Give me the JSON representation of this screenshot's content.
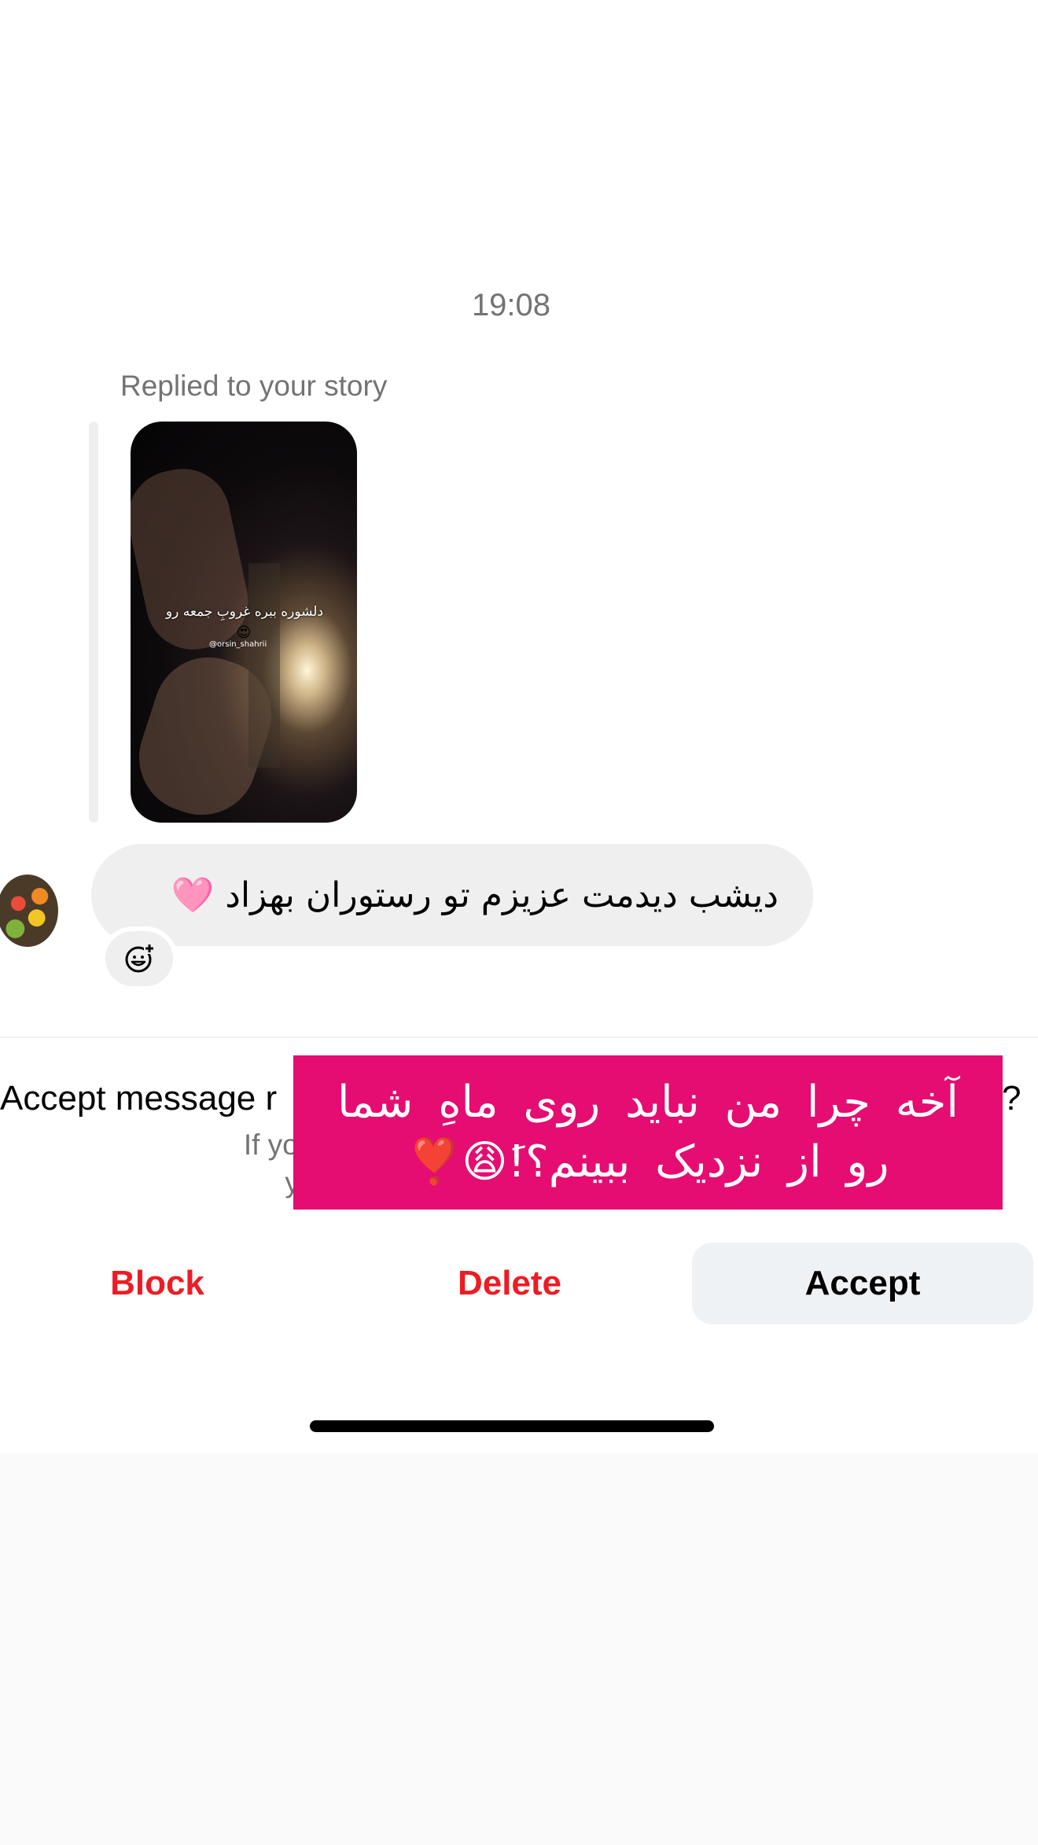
{
  "thread": {
    "timestamp": "19:08",
    "replied_label": "Replied to your story",
    "story": {
      "caption": "دلشوره ببره غروبِ جمعه رو",
      "caption_emoji": "😍",
      "handle": "@orsin_shahrii"
    },
    "message": {
      "text": "دیشب دیدمت عزیزم تو رستوران بهزاد",
      "emoji": "🩷"
    },
    "react_icon": "add-reaction-icon",
    "avatar_icon": "avatar-image"
  },
  "request": {
    "title": "Accept message r",
    "title_end": "?",
    "subtitle_line1": "If you accept, they",
    "subtitle_line2": "your activity"
  },
  "overlay": {
    "text": "آخه چرا من نباید روی ماهِ شما رو از نزدیک ببینم؟!َ😩❣️"
  },
  "actions": {
    "block": "Block",
    "delete": "Delete",
    "accept": "Accept"
  },
  "colors": {
    "destructive": "#ed1c24",
    "overlay": "#e50c72",
    "bubble": "#efefef"
  }
}
